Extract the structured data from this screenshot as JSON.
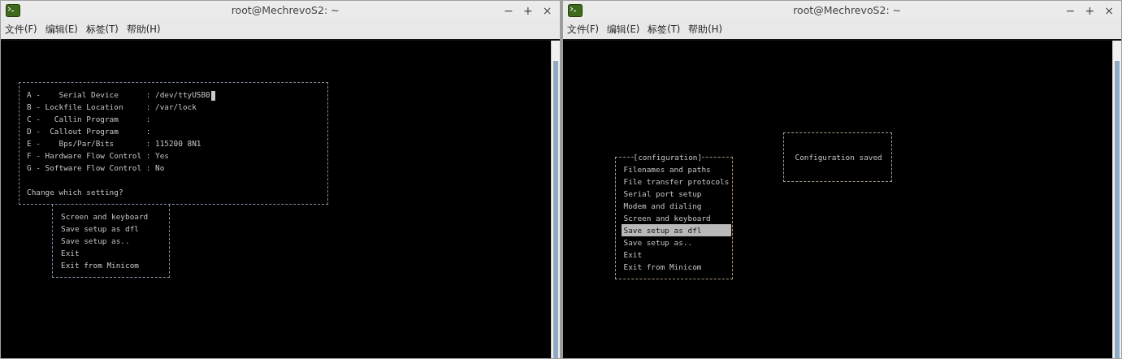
{
  "windows": [
    {
      "title": "root@MechrevoS2: ~",
      "controls": [
        "−",
        "+",
        "×"
      ],
      "menu": [
        "文件(F)",
        "编辑(E)",
        "标签(T)",
        "帮助(H)"
      ],
      "setup_panel": {
        "rows": [
          {
            "text": "A -    Serial Device      : /dev/ttyUSB0",
            "cursor": true
          },
          {
            "text": "B - Lockfile Location     : /var/lock",
            "cursor": false
          },
          {
            "text": "C -   Callin Program      :",
            "cursor": false
          },
          {
            "text": "D -  Callout Program      :",
            "cursor": false
          },
          {
            "text": "E -    Bps/Par/Bits       : 115200 8N1",
            "cursor": false
          },
          {
            "text": "F - Hardware Flow Control : Yes",
            "cursor": false
          },
          {
            "text": "G - Software Flow Control : No",
            "cursor": false
          }
        ],
        "prompt": "Change which setting?"
      },
      "menu_box": {
        "items": [
          {
            "label": "Screen and keyboard",
            "selected": false
          },
          {
            "label": "Save setup as dfl",
            "selected": false
          },
          {
            "label": "Save setup as..",
            "selected": false
          },
          {
            "label": "Exit",
            "selected": false
          },
          {
            "label": "Exit from Minicom",
            "selected": false
          }
        ]
      }
    },
    {
      "title": "root@MechrevoS2: ~",
      "controls": [
        "−",
        "+",
        "×"
      ],
      "menu": [
        "文件(F)",
        "编辑(E)",
        "标签(T)",
        "帮助(H)"
      ],
      "menu_box": {
        "title": "[configuration]",
        "items": [
          {
            "label": "Filenames and paths",
            "selected": false
          },
          {
            "label": "File transfer protocols",
            "selected": false
          },
          {
            "label": "Serial port setup",
            "selected": false
          },
          {
            "label": "Modem and dialing",
            "selected": false
          },
          {
            "label": "Screen and keyboard",
            "selected": false
          },
          {
            "label": "Save setup as dfl",
            "selected": true
          },
          {
            "label": "Save setup as..",
            "selected": false
          },
          {
            "label": "Exit",
            "selected": false
          },
          {
            "label": "Exit from Minicom",
            "selected": false
          }
        ]
      },
      "message_box": {
        "text": "Configuration saved"
      }
    }
  ]
}
